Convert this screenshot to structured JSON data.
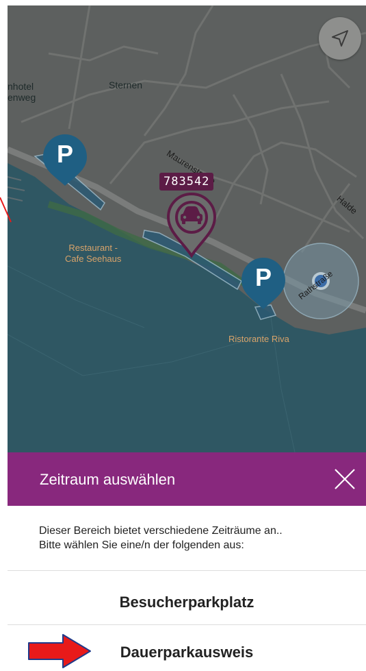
{
  "map": {
    "labels": {
      "hotel_line1": "nhotel",
      "hotel_line2": "enweg",
      "sternen": "Sternen",
      "maurenstrasse": "Maurenstraße",
      "halde": "Halde",
      "restaurant_line1": "Restaurant -",
      "restaurant_line2": "Cafe Seehaus",
      "rathstrasse": "Rathstraße",
      "ristorante": "Ristorante Riva"
    },
    "vehicle_plate": "783542",
    "parking_symbol": "P",
    "icons": {
      "locate": "navigation-arrow-icon",
      "vehicle": "car-icon",
      "parking": "parking-pin-icon",
      "location": "current-location-icon"
    }
  },
  "sheet": {
    "title": "Zeitraum auswählen",
    "close_icon": "close-icon",
    "description_line1": "Dieser Bereich bietet verschiedene Zeiträume an..",
    "description_line2": "Bitte wählen Sie eine/n der folgenden aus:",
    "options": [
      {
        "label": "Besucherparkplatz"
      },
      {
        "label": "Dauerparkausweis"
      }
    ]
  },
  "colors": {
    "header": "#88287d",
    "parking_pin": "#1f5f83",
    "vehicle_pin": "#5c1c46",
    "water": "#2f5763",
    "annotation_arrow": "#e81a1a"
  }
}
